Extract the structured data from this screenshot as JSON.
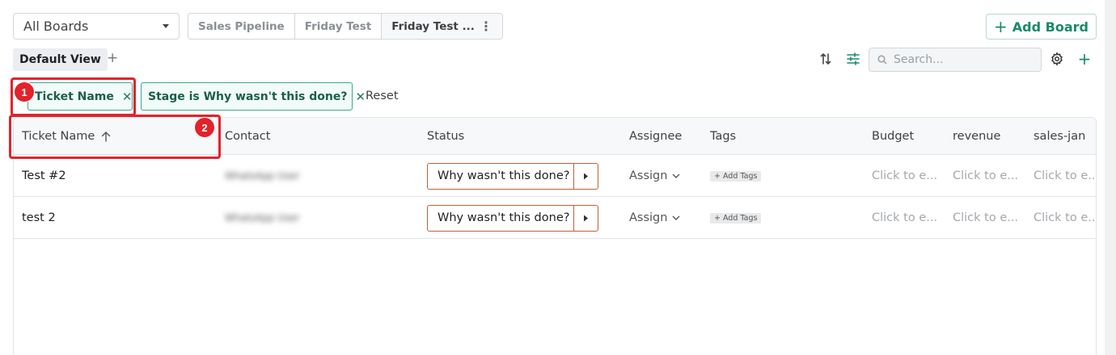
{
  "boards": {
    "selector_value": "All Boards",
    "tabs": [
      {
        "label": "Sales Pipeline"
      },
      {
        "label": "Friday Test"
      },
      {
        "label": "Friday Test ..."
      }
    ],
    "add_board_label": "Add Board"
  },
  "views": {
    "active": "Default View"
  },
  "search": {
    "placeholder": "Search..."
  },
  "filters": {
    "chips": [
      {
        "label": "Ticket Name"
      },
      {
        "label": "Stage is Why wasn't this done?"
      }
    ],
    "reset_label": "Reset"
  },
  "table": {
    "columns": [
      "Ticket Name",
      "Contact",
      "Status",
      "Assignee",
      "Tags",
      "Budget",
      "revenue",
      "sales-jan"
    ],
    "rows": [
      {
        "ticket_name": "Test #2",
        "contact": "WhatsApp User",
        "status": "Why wasn't this done?",
        "assignee": "Assign",
        "tags": "+ Add Tags",
        "budget": "Click to e...",
        "revenue": "Click to e...",
        "sales_jan": "Click to e..."
      },
      {
        "ticket_name": "test 2",
        "contact": "WhatsApp User",
        "status": "Why wasn't this done?",
        "assignee": "Assign",
        "tags": "+ Add Tags",
        "budget": "Click to e...",
        "revenue": "Click to e...",
        "sales_jan": "Click to e..."
      }
    ]
  },
  "annotations": {
    "badge_1": "1",
    "badge_2": "2"
  },
  "colors": {
    "accent": "#178a6a",
    "highlight": "#e3222b",
    "status_border": "#c0603b"
  }
}
